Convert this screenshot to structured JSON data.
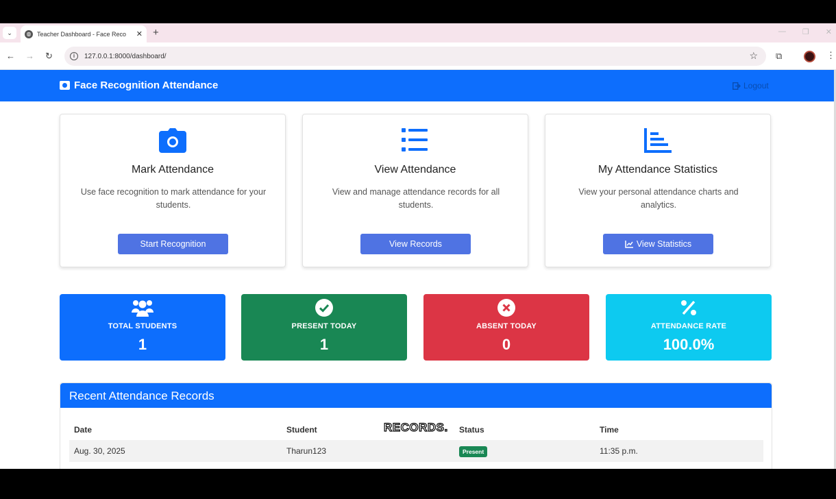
{
  "browser": {
    "tab_title": "Teacher Dashboard - Face Reco",
    "url": "127.0.0.1:8000/dashboard/"
  },
  "navbar": {
    "brand": "Face Recognition Attendance",
    "logout": "Logout"
  },
  "cards": [
    {
      "icon": "camera-icon",
      "title": "Mark Attendance",
      "text": "Use face recognition to mark attendance for your students.",
      "button": "Start Recognition"
    },
    {
      "icon": "list-icon",
      "title": "View Attendance",
      "text": "View and manage attendance records for all students.",
      "button": "View Records"
    },
    {
      "icon": "chart-icon",
      "title": "My Attendance Statistics",
      "text": "View your personal attendance charts and analytics.",
      "button": "View Statistics"
    }
  ],
  "stats": [
    {
      "icon": "users-icon",
      "label": "TOTAL STUDENTS",
      "value": "1",
      "color": "#0d6efd"
    },
    {
      "icon": "check-circle-icon",
      "label": "PRESENT TODAY",
      "value": "1",
      "color": "#198754"
    },
    {
      "icon": "x-circle-icon",
      "label": "ABSENT TODAY",
      "value": "0",
      "color": "#dc3545"
    },
    {
      "icon": "percent-icon",
      "label": "ATTENDANCE RATE",
      "value": "100.0%",
      "color": "#0dcaf0"
    }
  ],
  "records": {
    "title": "Recent Attendance Records",
    "columns": [
      "Date",
      "Student",
      "Status",
      "Time"
    ],
    "rows": [
      {
        "date": "Aug. 30, 2025",
        "student": "Tharun123",
        "status": "Present",
        "time": "11:35 p.m."
      }
    ]
  },
  "subtitle": "RECORDS."
}
